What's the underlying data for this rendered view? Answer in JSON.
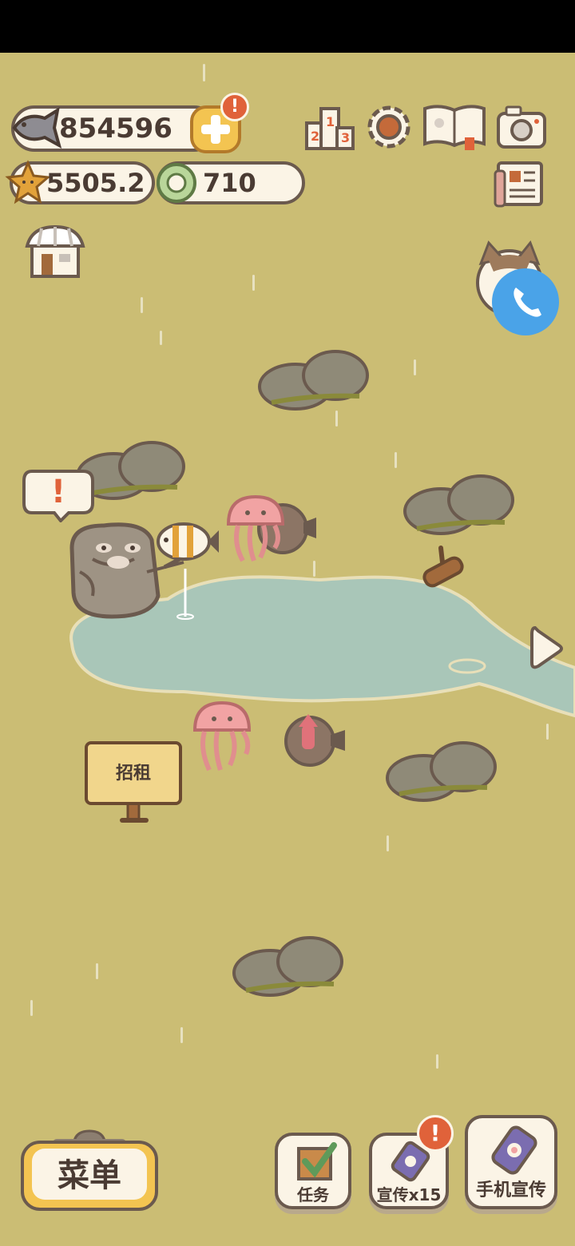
{
  "resources": {
    "fish_count": "854596",
    "starfish_count": "5505.2",
    "shell_count": "710"
  },
  "top_icons": {
    "ranking": "ranking-podium-icon",
    "settings": "gear-icon",
    "book": "paw-book-icon",
    "camera": "camera-icon",
    "news": "newspaper-icon",
    "shop": "shop-icon"
  },
  "alerts": {
    "add_badge": "!",
    "cat_bubble": "!",
    "promo_badge": "!"
  },
  "sign": {
    "label": "招租"
  },
  "bottom_bar": {
    "menu_label": "菜单",
    "tasks_label": "任务",
    "promo_label": "宣传x15",
    "phone_promo_label": "手机宣传"
  },
  "colors": {
    "grass": "#cbbd74",
    "pond": "#a9c6b8",
    "outline": "#6b5a4e",
    "cream": "#fbf4e6",
    "alert": "#e0623a",
    "call_button": "#4aa3e8"
  }
}
